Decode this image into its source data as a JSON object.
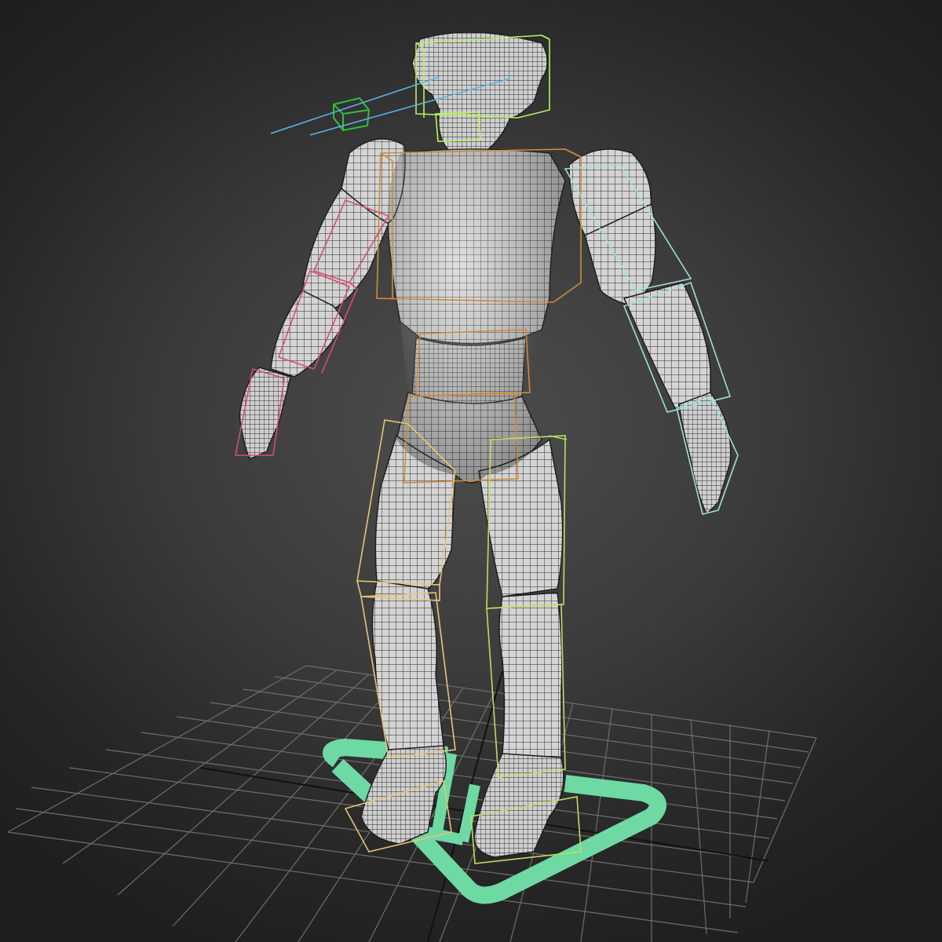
{
  "viewport": {
    "label": "",
    "shading_mode": "",
    "colors": {
      "grid": "#6e6e6e",
      "grid_axis": "#101010",
      "mesh_fill": "#cfcfcf",
      "mesh_wire": "#2a2a2a",
      "master_control": "#6fd9a4",
      "head_target": "#2fbf3a",
      "look_line": "#5ab4e6",
      "bone_spine": "#d08a3a",
      "bone_left_arm": "#d2506e",
      "bone_right_arm": "#9fe0d8",
      "bone_left_leg": "#e6c47a",
      "bone_right_leg": "#b8e060",
      "bone_head": "#b8f060"
    },
    "objects": [
      {
        "name": "character-mesh",
        "type": "editable-poly"
      },
      {
        "name": "biped-rig",
        "type": "bone-boxes"
      },
      {
        "name": "master-control",
        "type": "spline-arrow"
      },
      {
        "name": "look-at-target",
        "type": "helper-box"
      },
      {
        "name": "home-grid",
        "type": "grid"
      }
    ]
  }
}
